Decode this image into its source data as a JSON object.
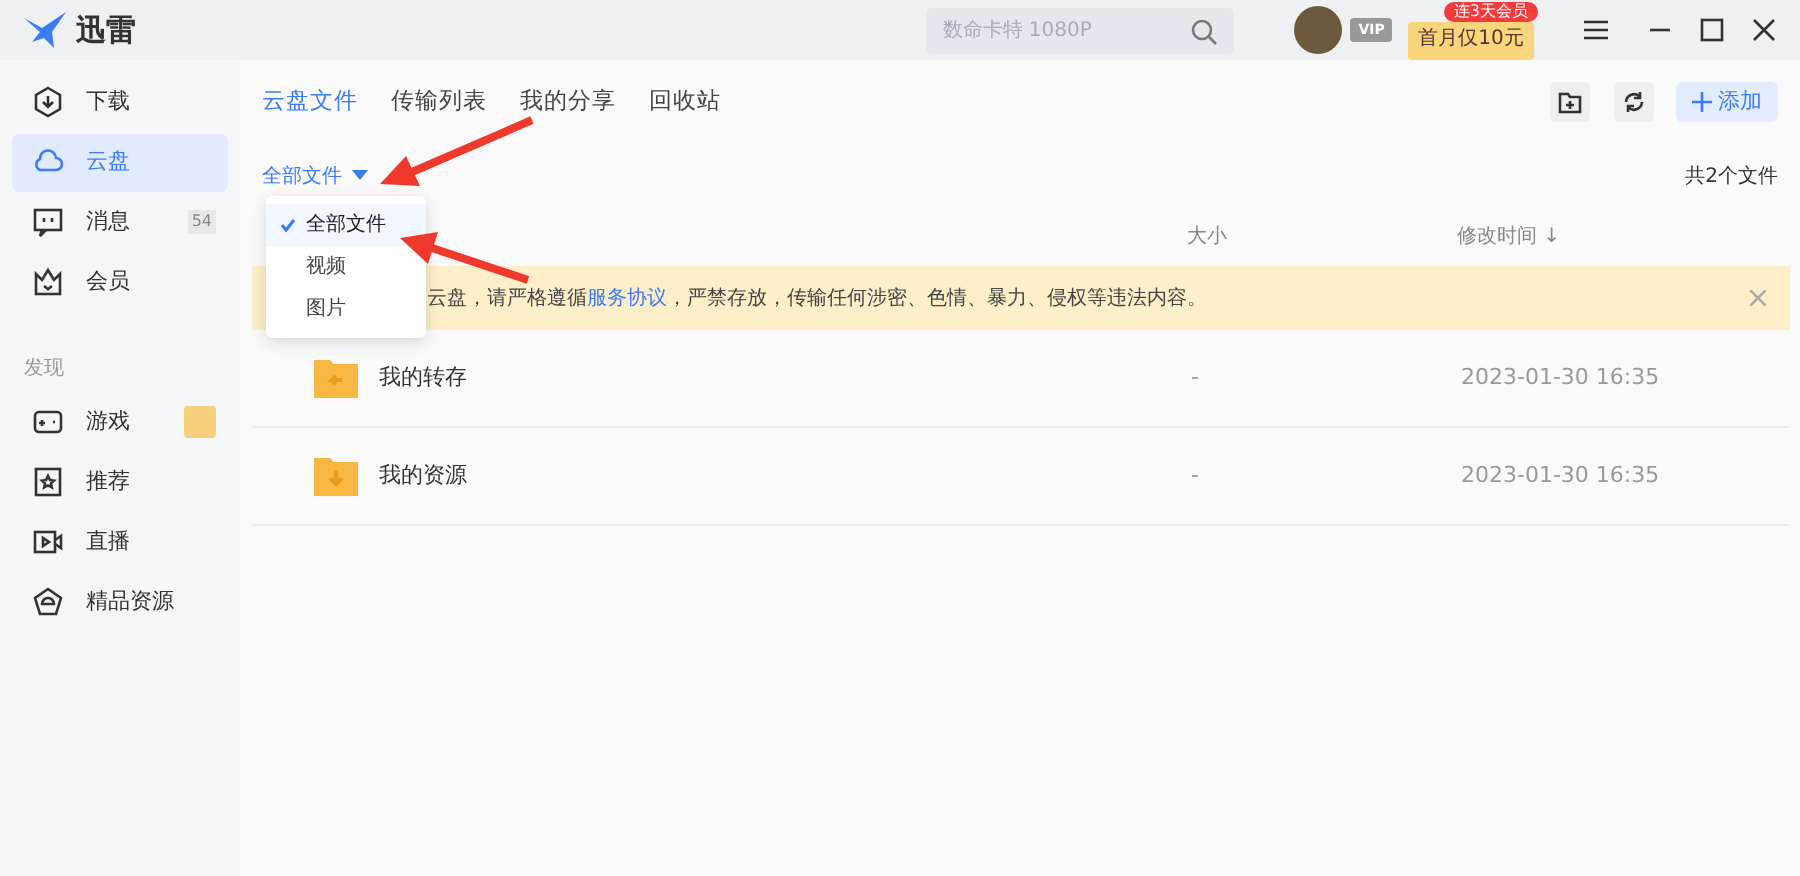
{
  "app": {
    "name": "迅雷"
  },
  "search": {
    "placeholder": "数命卡特 1080P"
  },
  "account": {
    "vip_label": "VIP",
    "promo": "首月仅10元",
    "promo_badge": "连3天会员"
  },
  "sidebar": {
    "items": [
      {
        "label": "下载",
        "kind": "download",
        "selected": false
      },
      {
        "label": "云盘",
        "kind": "cloud",
        "selected": true
      },
      {
        "label": "消息",
        "kind": "message",
        "selected": false,
        "count": "54"
      },
      {
        "label": "会员",
        "kind": "crown",
        "selected": false
      }
    ],
    "section": "发现",
    "discover": [
      {
        "label": "游戏",
        "kind": "game",
        "tag": true
      },
      {
        "label": "推荐",
        "kind": "star",
        "tag": false
      },
      {
        "label": "直播",
        "kind": "video",
        "tag": false
      },
      {
        "label": "精品资源",
        "kind": "gem",
        "tag": false
      }
    ]
  },
  "tabs": [
    {
      "label": "云盘文件",
      "selected": true
    },
    {
      "label": "传输列表",
      "selected": false
    },
    {
      "label": "我的分享",
      "selected": false
    },
    {
      "label": "回收站",
      "selected": false
    }
  ],
  "add_button": "添加",
  "filter": {
    "label": "全部文件",
    "expanded": true,
    "options": [
      {
        "label": "全部文件",
        "selected": true
      },
      {
        "label": "视频",
        "selected": false
      },
      {
        "label": "图片",
        "selected": false
      }
    ]
  },
  "file_count": "共2个文件",
  "table": {
    "columns": [
      "大小",
      "修改时间 ↓"
    ],
    "notice": {
      "before": "云盘，请严格遵循",
      "link": "服务协议",
      "after": "，严禁存放，传输任何涉密、色情、暴力、侵权等违法内容。"
    },
    "rows": [
      {
        "name": "我的转存",
        "kind": "transfer",
        "size": "-",
        "modified": "2023-01-30 16:35"
      },
      {
        "name": "我的资源",
        "kind": "resource",
        "size": "-",
        "modified": "2023-01-30 16:35"
      }
    ]
  }
}
